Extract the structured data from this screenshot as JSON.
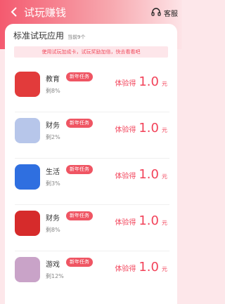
{
  "header": {
    "title": "试玩赚钱",
    "service_label": "客服"
  },
  "section": {
    "title": "标准试玩应用",
    "count": "当前9个",
    "notice": "使用试玩加成卡，试玩奖励加倍，快去看看吧"
  },
  "colors": {
    "accent": "#f2435a",
    "badge": "#ef5563"
  },
  "apps": [
    {
      "category": "教育",
      "badge": "新年任务",
      "remaining": "剩8%",
      "reward_prefix": "体验得",
      "reward_amount": "1.0",
      "reward_unit": "元",
      "icon_color": "#e23b3b"
    },
    {
      "category": "财务",
      "badge": "新年任务",
      "remaining": "剩2%",
      "reward_prefix": "体验得",
      "reward_amount": "1.0",
      "reward_unit": "元",
      "icon_color": "#b7c6ea"
    },
    {
      "category": "生活",
      "badge": "新年任务",
      "remaining": "剩3%",
      "reward_prefix": "体验得",
      "reward_amount": "1.0",
      "reward_unit": "元",
      "icon_color": "#2f6fe0"
    },
    {
      "category": "财务",
      "badge": "新年任务",
      "remaining": "剩8%",
      "reward_prefix": "体验得",
      "reward_amount": "1.0",
      "reward_unit": "元",
      "icon_color": "#d62b2b"
    },
    {
      "category": "游戏",
      "badge": "新年任务",
      "remaining": "剩12%",
      "reward_prefix": "体验得",
      "reward_amount": "1.0",
      "reward_unit": "元",
      "icon_color": "#c9a3c8"
    }
  ]
}
